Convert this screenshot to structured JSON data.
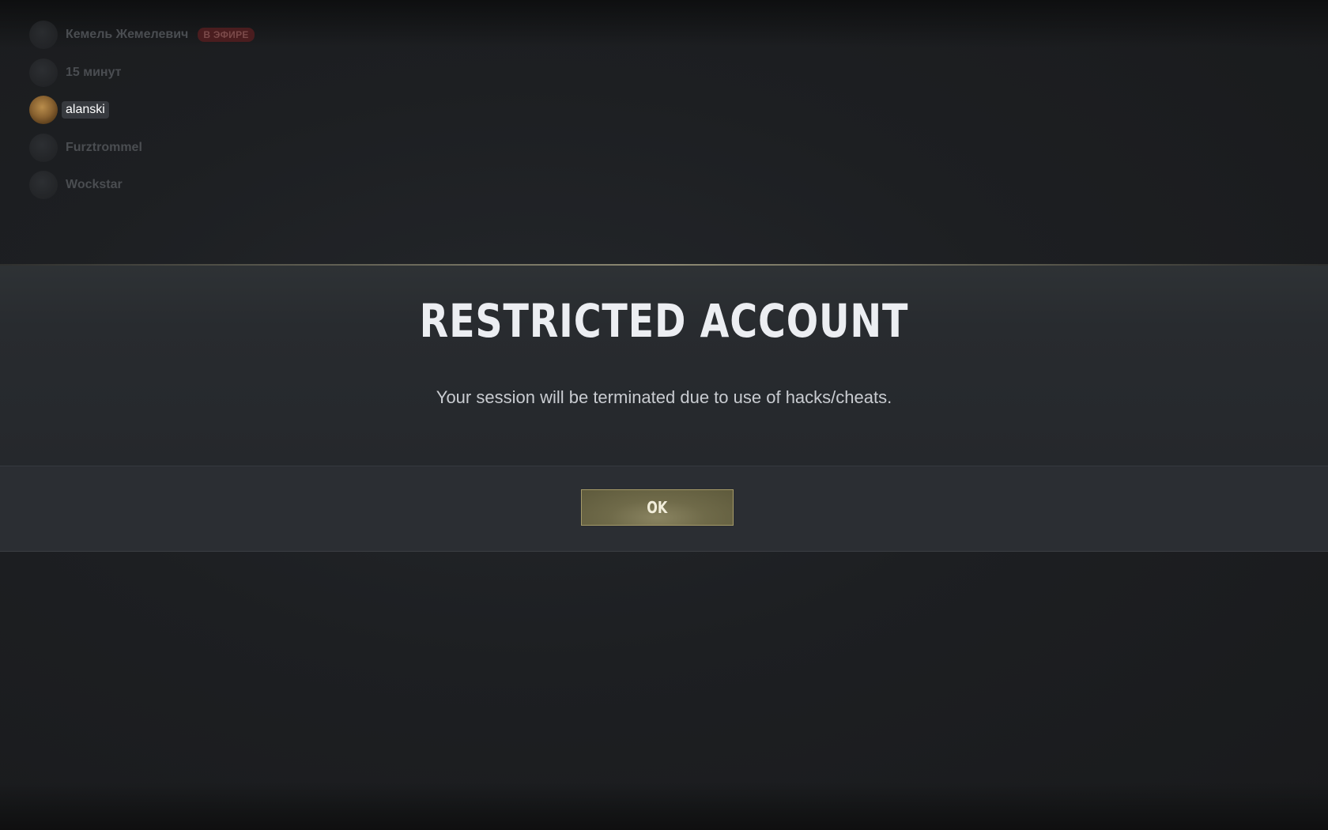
{
  "overlay": {
    "members": [
      {
        "name": "Кемель Жемелевич",
        "badge": "В ЭФИРЕ",
        "speaking": false
      },
      {
        "name": "15 минут",
        "speaking": false
      },
      {
        "name": "alanski",
        "speaking": true
      },
      {
        "name": "Furztrommel",
        "speaking": false
      },
      {
        "name": "Wockstar",
        "speaking": false
      }
    ]
  },
  "dialog": {
    "title": "RESTRICTED ACCOUNT",
    "message": "Your session will be terminated due to use of hacks/cheats.",
    "ok_label": "OK"
  },
  "colors": {
    "background": "#1d1f22",
    "modal_body": "#282b2f",
    "modal_footer": "#2b2e33",
    "accent_line": "#8e8a73",
    "button_fill": "#6f6a49",
    "button_border": "#a59a68",
    "live_badge": "#4a1d1f"
  }
}
